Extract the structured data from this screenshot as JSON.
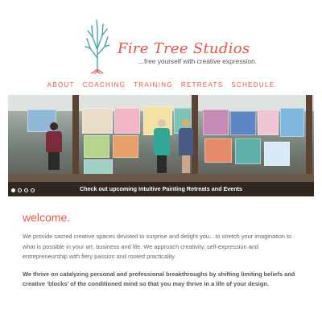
{
  "header": {
    "brand": "Fire Tree Studios",
    "tagline": "...free yourself with creative expression."
  },
  "nav": {
    "items": [
      "ABOUT",
      "COACHING",
      "TRAINING",
      "RETREATS",
      "SCHEDULE"
    ]
  },
  "hero": {
    "caption": "Check out upcoming Intuitive Painting Retreats and Events",
    "slide_count": 4,
    "active_slide": 1
  },
  "main": {
    "heading": "welcome.",
    "paragraph1": "We provide sacred creative spaces devoted to surprise and delight you…to stretch your imagination to what is possible in your art, business and life. We approach creativity, self-expression and entrepreneurship with fiery passion and rooted practicality.",
    "paragraph2": "We thrive on catalyzing personal and professional breakthroughs by shifting limiting beliefs and creative ‘blocks’ of the conditioned mind so that you may thrive in a life of your design."
  },
  "colors": {
    "accent": "#e0574a",
    "tree": "#3e9da2"
  },
  "icons": {
    "logo": "tree-logo-icon"
  }
}
